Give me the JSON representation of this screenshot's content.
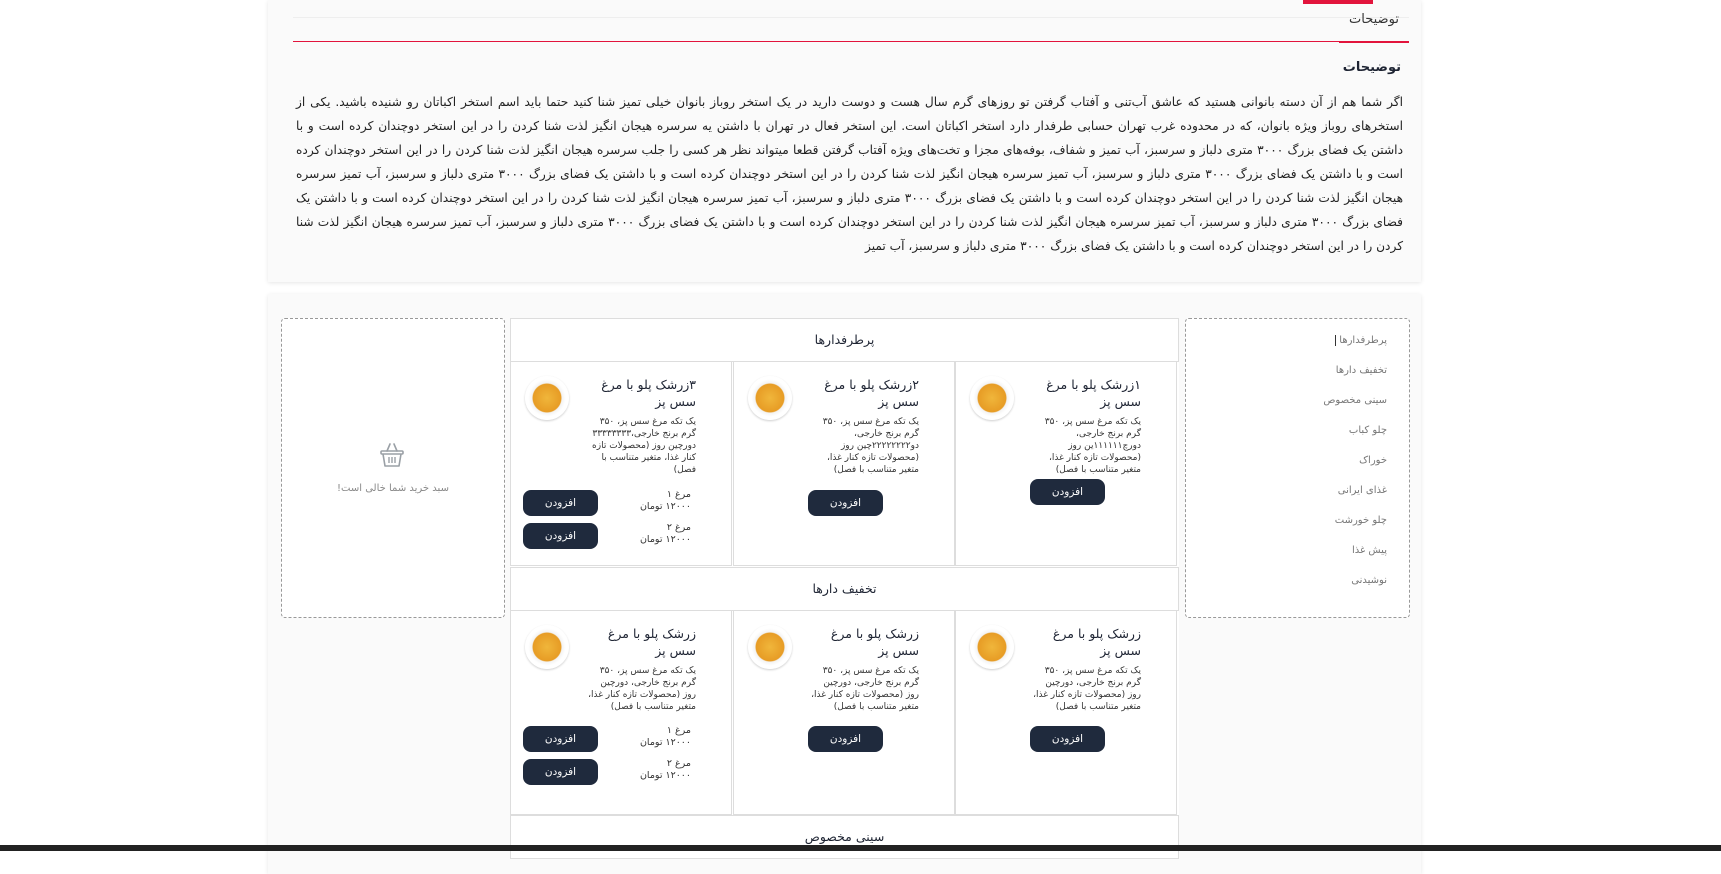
{
  "tab": {
    "label": "توضیحات"
  },
  "description": {
    "title": "توضیحات",
    "text": "اگر شما هم از آن دسته بانوانی هستید که عاشق آب‌تنی و آفتاب گرفتن تو روزهای گرم سال هست و دوست دارید در یک استخر روباز بانوان خیلی تمیز شنا کنید حتما باید اسم استخر اکباتان رو شنیده باشید. یکی از استخرهای روباز ویژه بانوان، که در محدوده غرب تهران حسابی طرفدار دارد استخر اکباتان است. این استخر فعال در تهران با داشتن یه سرسره هیجان انگیز لذت شنا کردن را در این استخر دوچندان کرده است و با داشتن یک فضای بزرگ ۳۰۰۰ متری دلباز و سرسبز، آب تمیز و شفاف، بوفه‌های مجزا و تخت‌های ویژه آفتاب گرفتن قطعا میتواند نظر هر کسی را جلب سرسره هیجان انگیز لذت شنا کردن را در این استخر دوچندان کرده است و با داشتن یک فضای بزرگ ۳۰۰۰ متری دلباز و سرسبز، آب تمیز سرسره هیجان انگیز لذت شنا کردن را در این استخر دوچندان کرده است و با داشتن یک فضای بزرگ ۳۰۰۰ متری دلباز و سرسبز، آب تمیز سرسره هیجان انگیز لذت شنا کردن را در این استخر دوچندان کرده است و با داشتن یک فضای بزرگ ۳۰۰۰ متری دلباز و سرسبز، آب تمیز سرسره هیجان انگیز لذت شنا کردن را در این استخر دوچندان کرده است و با داشتن یک فضای بزرگ ۳۰۰۰ متری دلباز و سرسبز، آب تمیز سرسره هیجان انگیز لذت شنا کردن را در این استخر دوچندان کرده است و با داشتن یک فضای بزرگ ۳۰۰۰ متری دلباز و سرسبز، آب تمیز سرسره هیجان انگیز لذت شنا کردن را در این استخر دوچندان کرده است و با داشتن یک فضای بزرگ ۳۰۰۰ متری دلباز و سرسبز، آب تمیز"
  },
  "sidebar": {
    "items": [
      "پرطرفدارها",
      "تخفیف دارها",
      "سینی مخصوص",
      "چلو کباب",
      "خوراک",
      "غذای ایرانی",
      "چلو خورشت",
      "پیش غذا",
      "نوشیدنی"
    ]
  },
  "cart": {
    "empty_text": "سبد خرید شما خالی است!"
  },
  "categories": [
    {
      "title": "پرطرفدارها",
      "products": [
        {
          "name": "۱زرشک پلو با مرغ سس پز",
          "desc": "یک تکه مرغ سس پز، ۳۵۰ گرم برنج خارجی، دورچ۱۱۱۱۱۱ین روز (محصولات تازه کنار غذا، متغیر متناسب با فصل)",
          "button": "افزودن"
        },
        {
          "name": "۲زرشک پلو با مرغ سس پز",
          "desc": "یک تکه مرغ سس پز، ۳۵۰ گرم برنج خارجی، دو۲۲۲۲۲۲۲۲چین روز (محصولات تازه کنار غذا، متغیر متناسب با فصل)",
          "button": "افزودن"
        },
        {
          "name": "۳زرشک پلو با مرغ سس پز",
          "desc": "یک تکه مرغ سس پز، ۳۵۰ گرم برنج خارجی،۳۳۳۳۳۳۳۳ دورچین روز (محصولات تازه کنار غذا، متغیر متناسب با فصل)",
          "button": "افزودن",
          "options": [
            {
              "name": "مرغ ۱",
              "price": "۱۲۰۰۰ تومان",
              "button": "افزودن"
            },
            {
              "name": "مرغ ۲",
              "price": "۱۲۰۰۰ تومان",
              "button": "افزودن"
            }
          ]
        }
      ]
    },
    {
      "title": "تخفیف دارها",
      "products": [
        {
          "name": "زرشک پلو با مرغ سس پز",
          "desc": "یک تکه مرغ سس پز، ۳۵۰ گرم برنج خارجی، دورچین روز (محصولات تازه کنار غذا، متغیر متناسب با فصل)",
          "button": "افزودن"
        },
        {
          "name": "زرشک پلو با مرغ سس پز",
          "desc": "یک تکه مرغ سس پز، ۳۵۰ گرم برنج خارجی، دورچین روز (محصولات تازه کنار غذا، متغیر متناسب با فصل)",
          "button": "افزودن"
        },
        {
          "name": "زرشک پلو با مرغ سس پز",
          "desc": "یک تکه مرغ سس پز، ۳۵۰ گرم برنج خارجی، دورچین روز (محصولات تازه کنار غذا، متغیر متناسب با فصل)",
          "button": "افزودن",
          "options": [
            {
              "name": "مرغ ۱",
              "price": "۱۲۰۰۰ تومان",
              "button": "افزودن"
            },
            {
              "name": "مرغ ۲",
              "price": "۱۲۰۰۰ تومان",
              "button": "افزودن"
            }
          ]
        }
      ]
    },
    {
      "title": "سینی مخصوص"
    }
  ],
  "colors": {
    "accent": "#e2143c",
    "button_bg": "#1f2a3d"
  }
}
